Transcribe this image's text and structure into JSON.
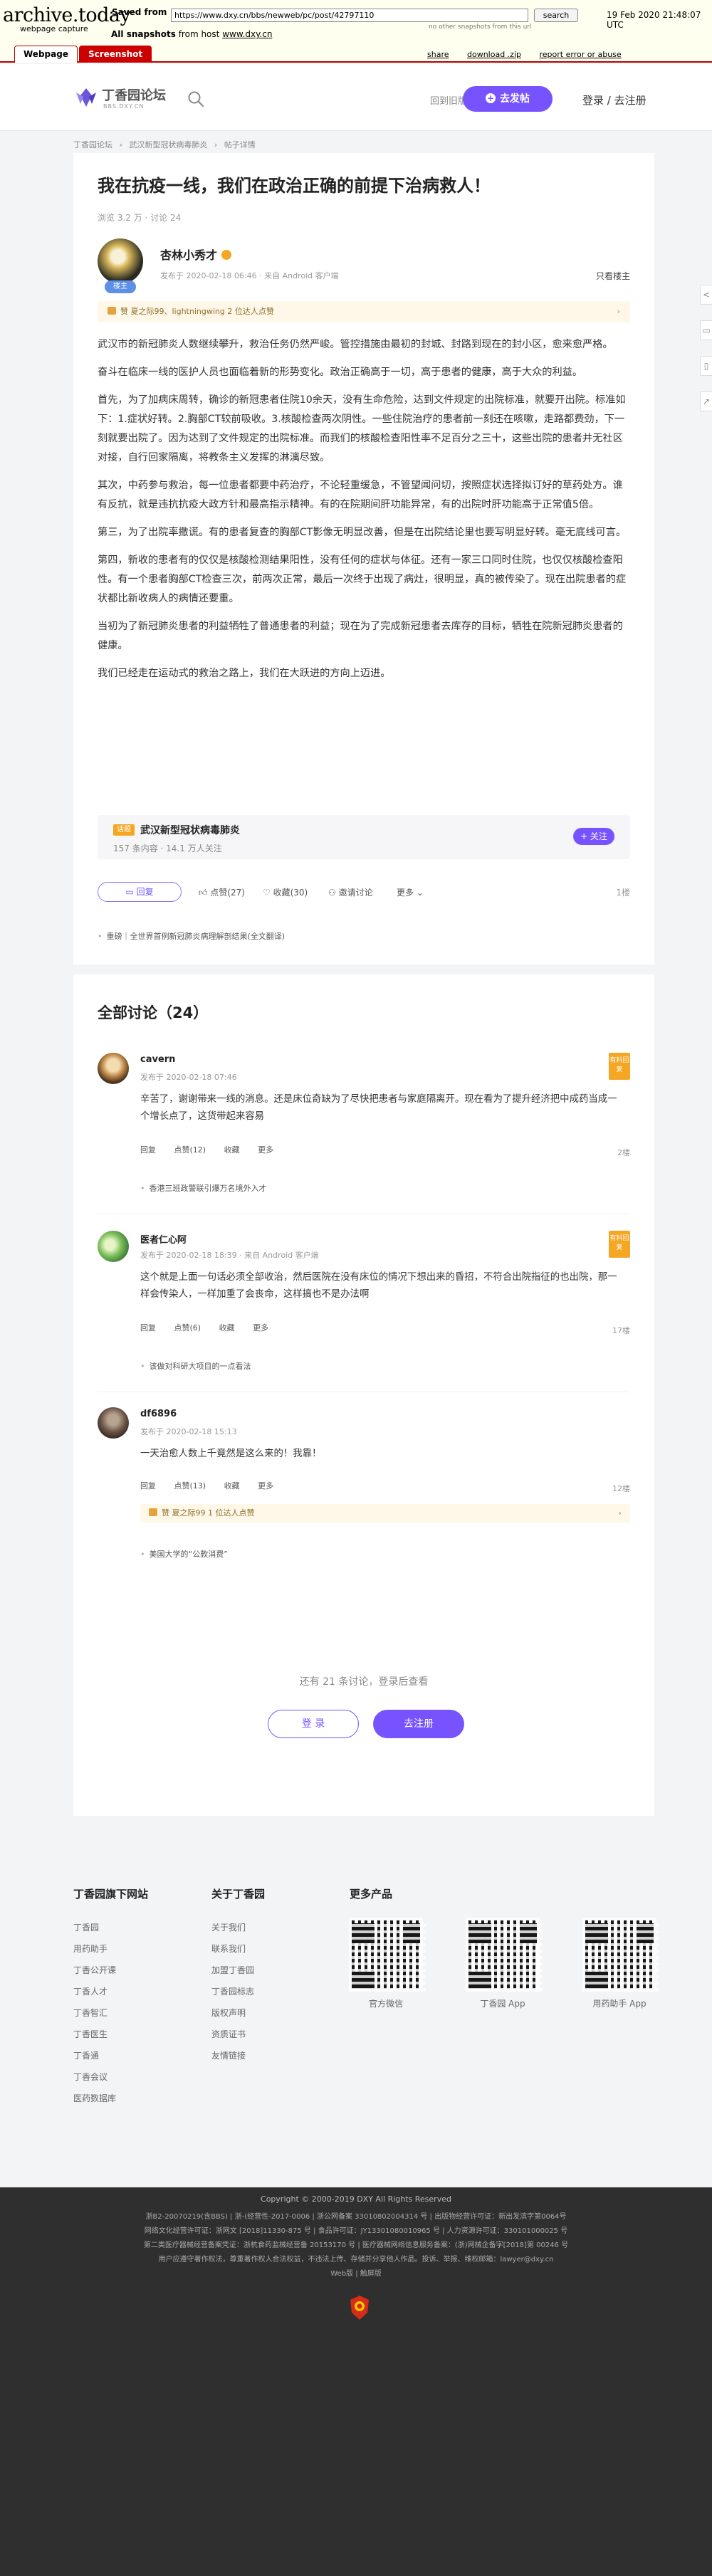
{
  "archive": {
    "logo": "archive.today",
    "subtitle": "webpage capture",
    "saved_from_label": "Saved from",
    "url": "https://www.dxy.cn/bbs/newweb/pc/post/42797110",
    "search_button": "search",
    "other_snapshots": "no other snapshots from this url",
    "date": "19 Feb 2020 21:48:07 UTC",
    "all_snapshots_prefix": "All snapshots",
    "all_snapshots_mid": "from host",
    "all_snapshots_host": "www.dxy.cn",
    "tabs": [
      "Webpage",
      "Screenshot"
    ],
    "tools": [
      "share",
      "download .zip",
      "report error or abuse"
    ]
  },
  "header": {
    "logo_text": "丁香园论坛",
    "logo_sub": "BBS.DXY.CN",
    "old_version": "回到旧版本",
    "post_button": "去发帖",
    "login": "登录 / 去注册"
  },
  "breadcrumb": [
    "丁香园论坛",
    "›",
    "武汉新型冠状病毒肺炎",
    "›",
    "帖子详情"
  ],
  "post": {
    "title": "我在抗疫一线，我们在政治正确的前提下治病救人！",
    "stats": "浏览 3.2 万 · 讨论 24",
    "author": "杏林小秀才",
    "avatar_badge": "楼主",
    "meta": "发布于 2020-02-18 06:46 · 来自 Android 客户端",
    "only_op": "只看楼主",
    "likes": "赞 夏之际99、lightningwing 2 位达人点赞",
    "paragraphs": [
      "武汉市的新冠肺炎人数继续攀升，救治任务仍然严峻。管控措施由最初的封城、封路到现在的封小区，愈来愈严格。",
      "奋斗在临床一线的医护人员也面临着新的形势变化。政治正确高于一切，高于患者的健康，高于大众的利益。",
      "首先，为了加病床周转，确诊的新冠患者住院10余天，没有生命危险，达到文件规定的出院标准，就要开出院。标准如下：1.症状好转。2.胸部CT较前吸收。3.核酸检查两次阴性。一些住院治疗的患者前一刻还在咳嗽，走路都费劲，下一刻就要出院了。因为达到了文件规定的出院标准。而我们的核酸检查阳性率不足百分之三十，这些出院的患者并无社区对接，自行回家隔离，将教条主义发挥的淋漓尽致。",
      "其次，中药参与救治，每一位患者都要中药治疗，不论轻重缓急，不管望闻问切，按照症状选择拟订好的草药处方。谁有反抗，就是违抗抗疫大政方针和最高指示精神。有的在院期间肝功能异常，有的出院时肝功能高于正常值5倍。",
      "第三，为了出院率撒谎。有的患者复查的胸部CT影像无明显改善，但是在出院结论里也要写明显好转。毫无底线可言。",
      "第四，新收的患者有的仅仅是核酸检测结果阳性，没有任何的症状与体征。还有一家三口同时住院，也仅仅核酸检查阳性。有一个患者胸部CT检查三次，前两次正常，最后一次终于出现了病灶，很明显，真的被传染了。现在出院患者的症状都比新收病人的病情还要重。",
      "当初为了新冠肺炎患者的利益牺牲了普通患者的利益；现在为了完成新冠患者去库存的目标，牺牲在院新冠肺炎患者的健康。",
      "我们已经走在运动式的救治之路上，我们在大跃进的方向上迈进。"
    ],
    "topic": {
      "tag": "话题",
      "name": "武汉新型冠状病毒肺炎",
      "sub": "157 条内容 · 14.1 万人关注",
      "follow": "+ 关注"
    },
    "actions": {
      "reply": "回复",
      "like": "点赞(27)",
      "fav": "收藏(30)",
      "invite": "邀请讨论",
      "more": "更多",
      "floor": "1楼"
    },
    "related": "重磅｜全世界首例新冠肺炎病理解剖结果(全文翻译)"
  },
  "comments": {
    "heading": "全部讨论（24）",
    "items": [
      {
        "name": "cavern",
        "meta": "发布于 2020-02-18 07:46",
        "badge": "有料回复",
        "text": "辛苦了，谢谢带来一线的消息。还是床位奇缺为了尽快把患者与家庭隔离开。现在看为了提升经济把中成药当成一个增长点了，这货带起来容易",
        "actions": [
          "回复",
          "点赞(12)",
          "收藏",
          "更多"
        ],
        "floor": "2楼",
        "related": "香港三班政警联引爆万名境外入才",
        "avatar_color": "#c08a4a"
      },
      {
        "name": "医者仁心阿",
        "meta": "发布于 2020-02-18 18:39 · 来自 Android 客户端",
        "badge": "有料回复",
        "text": "这个就是上面一句话必须全部收治，然后医院在没有床位的情况下想出来的昏招，不符合出院指征的也出院，那一样会传染人，一样加重了会丧命，这样搞也不是办法啊",
        "actions": [
          "回复",
          "点赞(6)",
          "收藏",
          "更多"
        ],
        "floor": "17楼",
        "related": "该做对科研大项目的一点看法",
        "avatar_color": "#7bbf5a"
      },
      {
        "name": "df6896",
        "meta": "发布于 2020-02-18 15:13",
        "badge": "",
        "text": "一天治愈人数上千竟然是这么来的！我靠！",
        "actions": [
          "回复",
          "点赞(13)",
          "收藏",
          "更多"
        ],
        "floor": "12楼",
        "likes": "赞 夏之际99 1 位达人点赞",
        "related": "美国大学的“公款消费”",
        "avatar_color": "#6b5446"
      }
    ],
    "more_text": "还有 21 条讨论，登录后查看",
    "login": "登 录",
    "register": "去注册"
  },
  "footer": {
    "col1_title": "丁香园旗下网站",
    "col1": [
      "丁香园",
      "用药助手",
      "丁香公开课",
      "丁香人才",
      "丁香智汇",
      "丁香医生",
      "丁香通",
      "丁香会议",
      "医药数据库"
    ],
    "col2_title": "关于丁香园",
    "col2": [
      "关于我们",
      "联系我们",
      "加盟丁香园",
      "丁香园标志",
      "版权声明",
      "资质证书",
      "友情链接"
    ],
    "col3_title": "更多产品",
    "qr_labels": [
      "官方微信",
      "丁香园 App",
      "用药助手 App"
    ],
    "copyright": "Copyright © 2000-2019 DXY All Rights Reserved",
    "licenses": [
      "浙B2-20070219(含BBS) | 浙-(经营性-2017-0006 | 浙公网备案 33010802004314 号 | 出版物经营许可证：新出发滨字第0064号",
      "网络文化经营许可证：浙网文 [2018]11330-875 号 | 食品许可证：JY13301080010965 号 | 人力资源许可证：330101000025 号",
      "第二类医疗器械经营备案凭证：浙杭食药监械经营备 20153170 号 | 医疗器械网络信息服务备案：(浙)网械企备字[2018]第 00246 号",
      "用户应遵守著作权法，尊重著作权人合法权益，不违法上传、存储并分享他人作品。投诉、举报、维权邮箱：lawyer@dxy.cn",
      "Web版 | 触屏版"
    ]
  },
  "colors": {
    "brand": "#7753ff",
    "archive_red": "#b00000",
    "badge_orange": "#f5a623"
  }
}
